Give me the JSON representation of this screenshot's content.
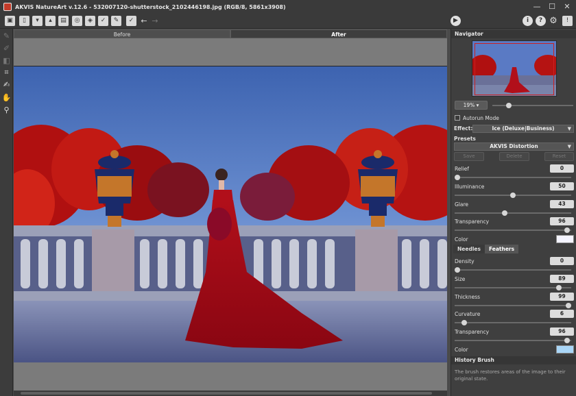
{
  "window": {
    "title": "AKVIS NatureArt v.12.6 - 532007120-shutterstock_2102446198.jpg (RGB/8, 5861x3908)"
  },
  "toolbar": {
    "icons": [
      "open-file-icon",
      "new-file-icon",
      "save-icon",
      "export-icon",
      "print-icon",
      "share-icon",
      "batch-icon",
      "brush-icon",
      "edit-icon",
      "history-icon",
      "undo-icon",
      "redo-icon",
      "run-icon",
      "info-icon",
      "help-icon",
      "settings-icon",
      "notify-icon"
    ]
  },
  "tabs": [
    {
      "label": "Before",
      "active": false
    },
    {
      "label": "After",
      "active": true
    }
  ],
  "navigator": {
    "title": "Navigator",
    "zoom": "19%"
  },
  "autorun": {
    "label": "Autorun Mode",
    "checked": false
  },
  "effect": {
    "label": "Effect:",
    "value": "Ice (Deluxe|Business)"
  },
  "presets": {
    "title": "Presets",
    "value": "AKVIS Distortion",
    "buttons": [
      "Save",
      "Delete",
      "Reset"
    ]
  },
  "params": [
    {
      "label": "Relief",
      "value": "0",
      "pos": 0.0
    },
    {
      "label": "Illuminance",
      "value": "50",
      "pos": 0.5
    },
    {
      "label": "Glare",
      "value": "43",
      "pos": 0.43
    },
    {
      "label": "Transparency",
      "value": "96",
      "pos": 0.96
    }
  ],
  "color1": {
    "label": "Color",
    "value": "#f4f4ff"
  },
  "subtabs": [
    {
      "label": "Needles",
      "active": false
    },
    {
      "label": "Feathers",
      "active": true
    }
  ],
  "feather_params": [
    {
      "label": "Density",
      "value": "0",
      "pos": 0.0
    },
    {
      "label": "Size",
      "value": "89",
      "pos": 0.89
    },
    {
      "label": "Thickness",
      "value": "99",
      "pos": 0.99
    },
    {
      "label": "Curvature",
      "value": "6",
      "pos": 0.06
    },
    {
      "label": "Transparency",
      "value": "96",
      "pos": 0.96
    }
  ],
  "color2": {
    "label": "Color",
    "value": "#a9d6f7"
  },
  "history_brush": {
    "title": "History Brush",
    "text": "The brush restores areas of the image to their original state."
  }
}
